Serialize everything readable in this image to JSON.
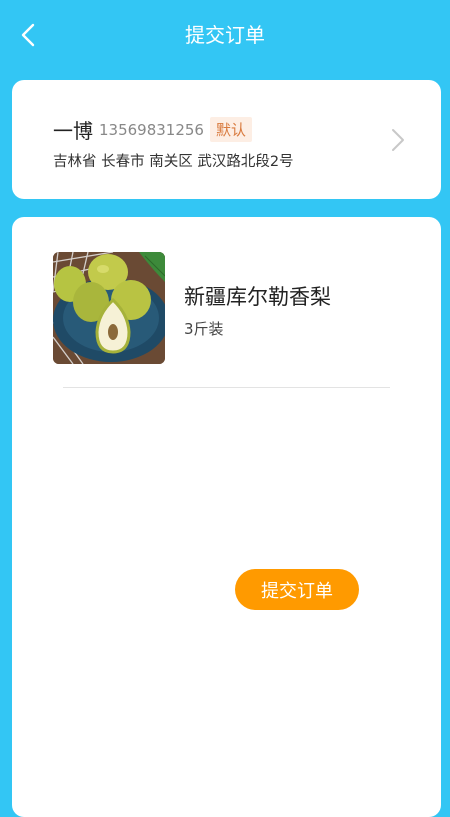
{
  "header": {
    "back_icon": "chevron-left-icon",
    "title": "提交订单"
  },
  "address": {
    "name": "一博",
    "phone": "13569831256",
    "badge": "默认",
    "detail": "吉林省 长春市 南关区 武汉路北段2号",
    "chevron_icon": "chevron-right-icon"
  },
  "product": {
    "image_icon": "pear-fruit-image",
    "name": "新疆库尔勒香梨",
    "spec": "3斤装"
  },
  "actions": {
    "submit_label": "提交订单"
  },
  "colors": {
    "background": "#33c6f4",
    "accent_button": "#ff9a00",
    "badge_text": "#d97b3f",
    "badge_bg": "#fdeee4"
  }
}
